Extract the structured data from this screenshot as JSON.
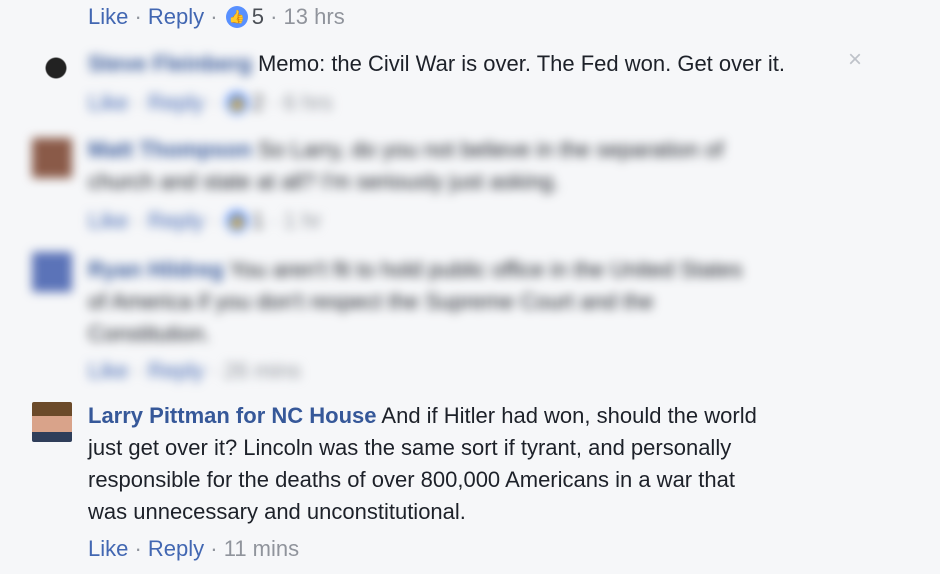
{
  "top": {
    "like_label": "Like",
    "reply_label": "Reply",
    "reaction_count": "5",
    "time": "13 hrs"
  },
  "comment1": {
    "author": "Steve Fleinberg",
    "text": "Memo: the Civil War is over. The Fed won. Get over it.",
    "like_label": "Like",
    "reply_label": "Reply",
    "reaction_count": "2",
    "time": "6 hrs"
  },
  "comment2": {
    "author": "Matt Thompson",
    "text_line1": "So Larry, do you not believe in the separation of",
    "text_line2": "church and state at all? I'm seriously just asking.",
    "like_label": "Like",
    "reply_label": "Reply",
    "reaction_count": "1",
    "time": "1 hr"
  },
  "comment3": {
    "author": "Ryan Hildreg",
    "text_line1": "You aren't fit to hold public office in the United States",
    "text_line2": "of America if you don't respect the Supreme Court and the",
    "text_line3": "Constitution.",
    "like_label": "Like",
    "reply_label": "Reply",
    "time": "26 mins"
  },
  "comment4": {
    "author": "Larry Pittman for NC House",
    "text_line1": "And if Hitler had won, should the world",
    "text_line2": "just get over it? Lincoln was the same sort if tyrant, and personally",
    "text_line3": "responsible for the deaths of over 800,000 Americans in a war that",
    "text_line4": "was unnecessary and unconstitutional.",
    "like_label": "Like",
    "reply_label": "Reply",
    "time": "11 mins"
  },
  "icons": {
    "close": "×",
    "like": "👍"
  }
}
